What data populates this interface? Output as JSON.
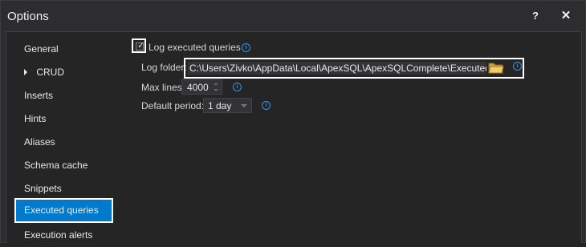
{
  "window": {
    "title": "Options",
    "help_label": "?",
    "close_label": "✕"
  },
  "nav": {
    "items": [
      {
        "label": "General"
      },
      {
        "label": "CRUD",
        "expandable": true
      },
      {
        "label": "Inserts"
      },
      {
        "label": "Hints"
      },
      {
        "label": "Aliases"
      },
      {
        "label": "Schema cache"
      },
      {
        "label": "Snippets"
      },
      {
        "label": "Executed queries",
        "selected": true
      },
      {
        "label": "Execution alerts"
      }
    ]
  },
  "options": {
    "log_checkbox": {
      "label": "Log executed queries",
      "checked": true
    },
    "log_folder": {
      "label": "Log folder:",
      "value": "C:\\Users\\Zivko\\AppData\\Local\\ApexSQL\\ApexSQLComplete\\ExecutedQueries"
    },
    "max_lines": {
      "label": "Max lines:",
      "value": "4000"
    },
    "default_period": {
      "label": "Default period:",
      "value": "1 day"
    }
  },
  "icons": {
    "info": "info-icon",
    "folder": "folder-open-icon",
    "check": "check-icon"
  },
  "colors": {
    "accent": "#007acc",
    "info": "#2f95e8",
    "background": "#252526"
  }
}
